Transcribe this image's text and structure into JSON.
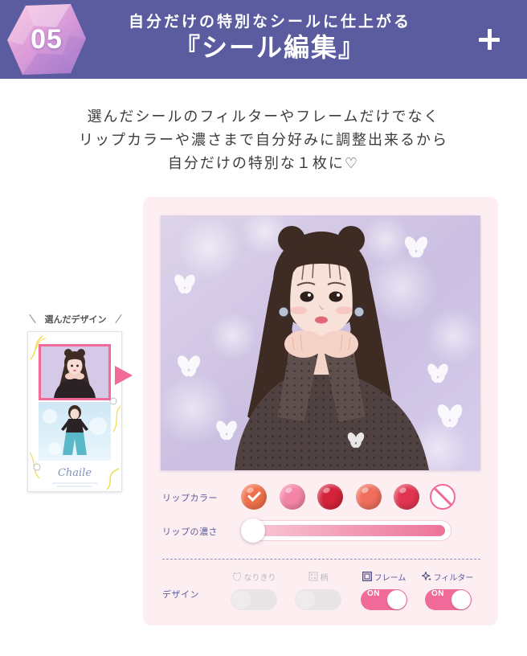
{
  "theme": {
    "header_bg": "#5b5c9f",
    "accent": "#f06a9a",
    "panel_bg": "#fdeef1",
    "label_color": "#5b5c9f"
  },
  "header": {
    "step_number": "05",
    "subtitle": "自分だけの特別なシールに仕上がる",
    "title": "『シール編集』",
    "expand_icon": "plus-icon"
  },
  "intro": {
    "lines": [
      "選んだシールのフィルターやフレームだけでなく",
      "リップカラーや濃さまで自分好みに調整出来るから",
      "自分だけの特別な１枚に♡"
    ]
  },
  "selected_design": {
    "label": "選んだデザイン",
    "sticker_brand": "Chaile"
  },
  "editor": {
    "lip_color": {
      "label": "リップカラー",
      "selected_index": 0,
      "swatches": [
        {
          "color": "#f0704b"
        },
        {
          "color": "#f585a8"
        },
        {
          "color": "#d3233a"
        },
        {
          "color": "#ef6f5c"
        },
        {
          "color": "#e23551"
        },
        {
          "color": "none",
          "icon": "no-color-icon"
        }
      ]
    },
    "lip_density": {
      "label": "リップの濃さ",
      "value": 0
    },
    "design": {
      "label": "デザイン",
      "options": [
        {
          "label": "なりきり",
          "icon": "mask-icon",
          "enabled": false,
          "on": false
        },
        {
          "label": "柄",
          "icon": "pattern-icon",
          "enabled": false,
          "on": false
        },
        {
          "label": "フレーム",
          "icon": "frame-icon",
          "enabled": true,
          "on": true,
          "state_text": "ON"
        },
        {
          "label": "フィルター",
          "icon": "sparkle-icon",
          "enabled": true,
          "on": true,
          "state_text": "ON"
        }
      ]
    }
  }
}
